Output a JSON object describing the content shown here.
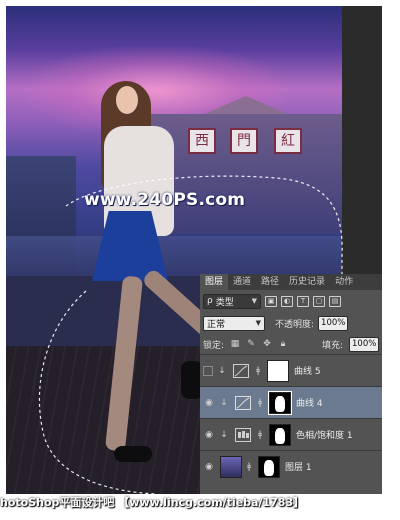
{
  "photo": {
    "watermark": "www.240PS.com",
    "sign_chars": [
      "西",
      "門",
      "紅"
    ]
  },
  "layers_panel": {
    "tabs": [
      "图层",
      "通道",
      "路径",
      "历史记录",
      "动作"
    ],
    "active_tab": "图层",
    "filter": {
      "label": "类型",
      "prefix": "ρ"
    },
    "blend_mode": "正常",
    "opacity_label": "不透明度:",
    "opacity_value": "100%",
    "lock_label": "锁定:",
    "fill_label": "填充:",
    "fill_value": "100%",
    "layers": [
      {
        "name": "曲线 5",
        "visible": false,
        "selected": false
      },
      {
        "name": "曲线 4",
        "visible": true,
        "selected": true
      },
      {
        "name": "色相/饱和度 1",
        "visible": true,
        "selected": false
      },
      {
        "name": "图层 1",
        "visible": true,
        "selected": false
      }
    ]
  },
  "footer": {
    "text": "hotoShop平面设计吧 【www.lincg.com/tieba/1783】"
  },
  "colors": {
    "panel_bg": "#535353",
    "tab_bar_bg": "#3d3d3d",
    "selected_layer": "#6b7a8f"
  }
}
